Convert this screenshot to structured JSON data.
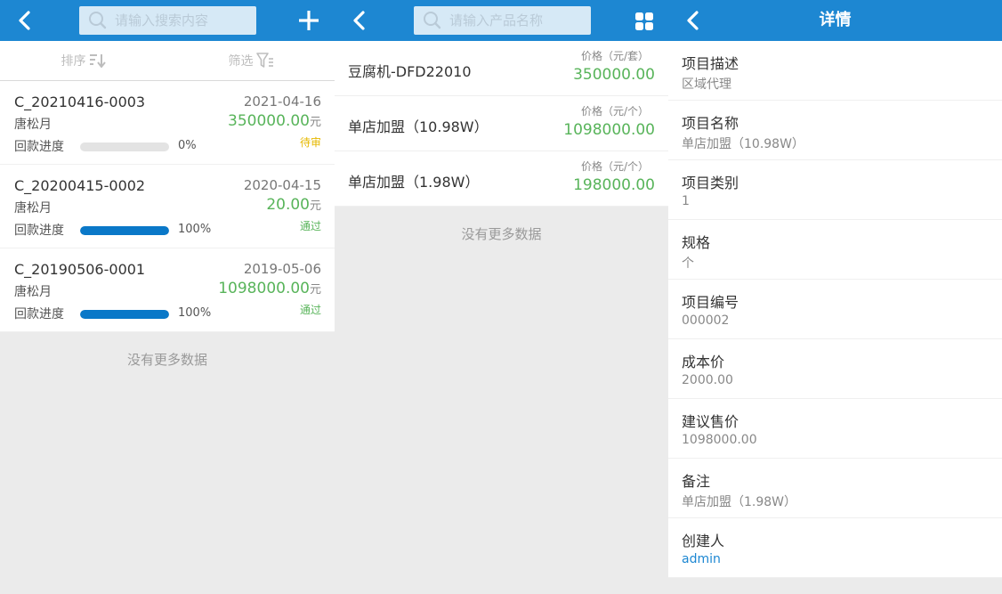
{
  "colors": {
    "topbar": "#1d87d2",
    "green": "#58b45a",
    "pending": "#e6b800",
    "passed": "#58b45a",
    "link": "#1d87d2",
    "progress": "#0a78c8"
  },
  "orders_screen": {
    "search_placeholder": "请输入搜索内容",
    "sort_label": "排序",
    "filter_label": "筛选",
    "orders": [
      {
        "code": "C_20210416-0003",
        "date": "2021-04-16",
        "person": "唐松月",
        "amount": "350000.00",
        "unit": "元",
        "status": "待审",
        "status_color": "#e6b800",
        "progress_label": "回款进度",
        "progress": 0,
        "progress_text": "0%"
      },
      {
        "code": "C_20200415-0002",
        "date": "2020-04-15",
        "person": "唐松月",
        "amount": "20.00",
        "unit": "元",
        "status": "通过",
        "status_color": "#58b45a",
        "progress_label": "回款进度",
        "progress": 100,
        "progress_text": "100%"
      },
      {
        "code": "C_20190506-0001",
        "date": "2019-05-06",
        "person": "唐松月",
        "amount": "1098000.00",
        "unit": "元",
        "status": "通过",
        "status_color": "#58b45a",
        "progress_label": "回款进度",
        "progress": 100,
        "progress_text": "100%"
      }
    ],
    "no_more": "没有更多数据"
  },
  "products_screen": {
    "search_placeholder": "请输入产品名称",
    "products": [
      {
        "name": "豆腐机-DFD22010",
        "price_label": "价格（元/套）",
        "price": "350000.00"
      },
      {
        "name": "单店加盟（10.98W）",
        "price_label": "价格（元/个）",
        "price": "1098000.00"
      },
      {
        "name": "单店加盟（1.98W）",
        "price_label": "价格（元/个）",
        "price": "198000.00"
      }
    ],
    "no_more": "没有更多数据"
  },
  "detail_screen": {
    "title": "详情",
    "fields": [
      {
        "label": "项目描述",
        "value": "区域代理"
      },
      {
        "label": "项目名称",
        "value": "单店加盟（10.98W）"
      },
      {
        "label": "项目类别",
        "value": "1"
      },
      {
        "label": "规格",
        "value": "个"
      },
      {
        "label": "项目编号",
        "value": "000002"
      },
      {
        "label": "成本价",
        "value": "2000.00"
      },
      {
        "label": "建议售价",
        "value": "1098000.00"
      },
      {
        "label": "备注",
        "value": "单店加盟（1.98W）"
      },
      {
        "label": "创建人",
        "value": "admin"
      }
    ]
  }
}
